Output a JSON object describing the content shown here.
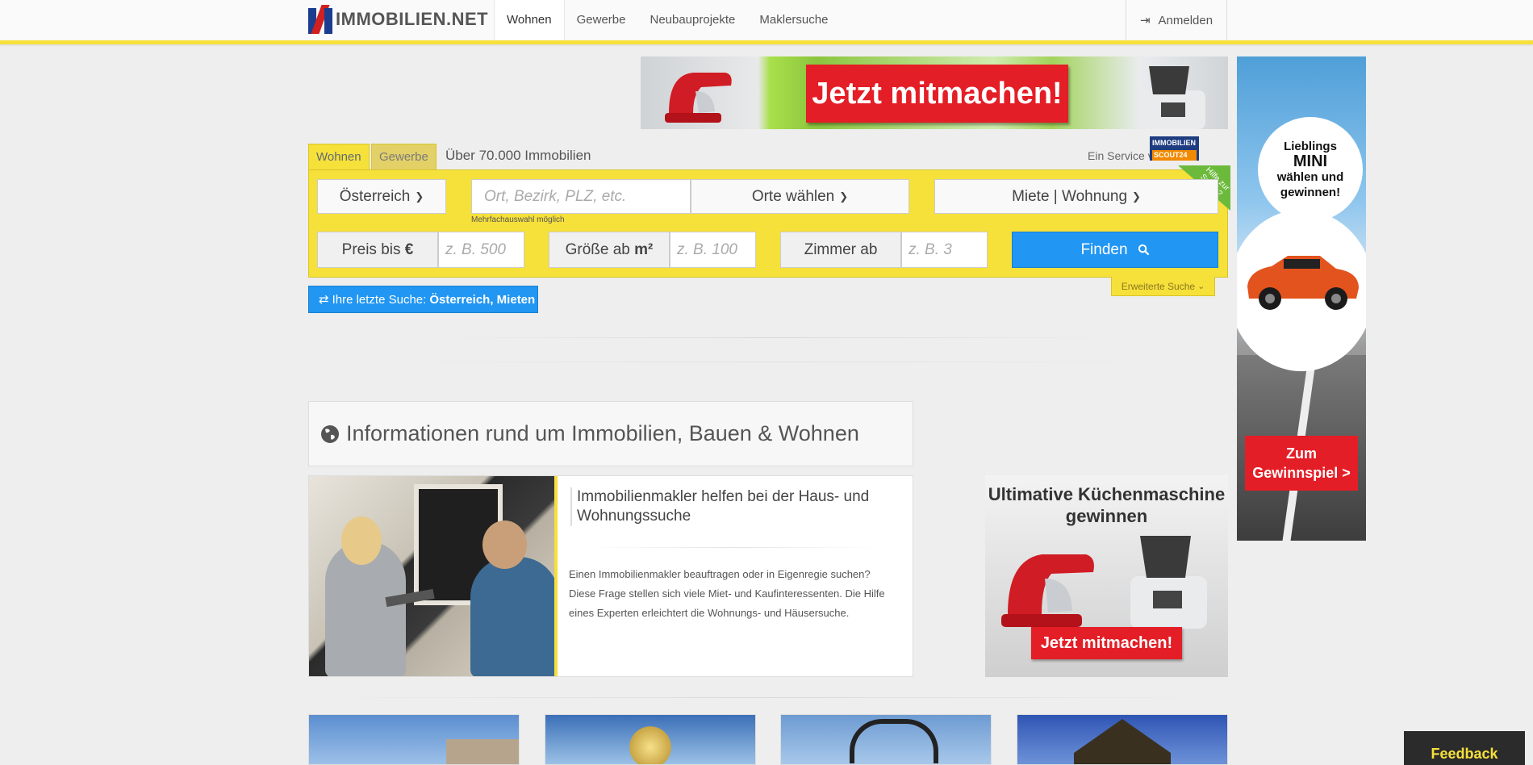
{
  "header": {
    "logo_text": "IMMOBILIEN.NET",
    "nav": [
      "Wohnen",
      "Gewerbe",
      "Neubauprojekte",
      "Maklersuche"
    ],
    "login_label": "Anmelden"
  },
  "ads": {
    "top_banner_cta": "Jetzt mitmachen!",
    "side_banner": {
      "line1": "Lieblings",
      "line2": "MINI",
      "line3": "wählen und",
      "line4": "gewinnen!",
      "cta_line1": "Zum",
      "cta_line2": "Gewinnspiel >"
    },
    "kitchen": {
      "title": "Ultimative Küchenmaschine gewinnen",
      "cta": "Jetzt mitmachen!"
    }
  },
  "search": {
    "tabs": [
      "Wohnen",
      "Gewerbe"
    ],
    "count_text": "Über 70.000 Immobilien",
    "service_text": "Ein Service von",
    "scout_line1": "IMMOBILIEN",
    "scout_line2": "SCOUT24",
    "help_ribbon": "Hilfe zur Suche?",
    "country": "Österreich",
    "location_placeholder": "Ort, Bezirk, PLZ, etc.",
    "location_hint": "Mehrfachauswahl möglich",
    "places_button": "Orte wählen",
    "type_select": "Miete | Wohnung",
    "price_label": "Preis bis",
    "price_unit": "€",
    "price_placeholder": "z. B. 500",
    "size_label": "Größe ab",
    "size_unit": "m²",
    "size_placeholder": "z. B. 100",
    "rooms_label": "Zimmer ab",
    "rooms_placeholder": "z. B. 3",
    "find_button": "Finden",
    "advanced": "Erweiterte Suche",
    "last_search_prefix": "Ihre letzte Suche:",
    "last_search_value": "Österreich, Mieten"
  },
  "info": {
    "heading": "Informationen rund um Immobilien, Bauen & Wohnen",
    "card_title": "Immobilienmakler helfen bei der Haus- und Wohnungssuche",
    "card_text": "Einen Immobilienmakler beauftragen oder in Eigenregie suchen? Diese Frage stellen sich viele Miet- und Kaufinteressenten. Die Hilfe eines Experten erleichtert die Wohnungs- und Häusersuche."
  },
  "feedback_label": "Feedback",
  "colors": {
    "accent_yellow": "#f6e03a",
    "button_blue": "#2196f3",
    "ad_red": "#e41e26"
  }
}
